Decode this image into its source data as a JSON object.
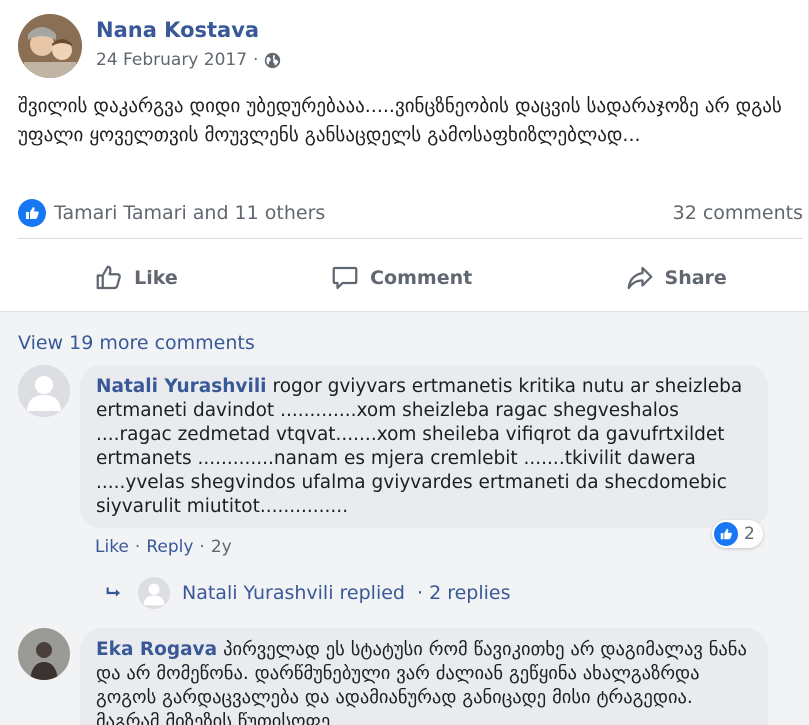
{
  "post": {
    "author": "Nana Kostava",
    "date": "24 February 2017",
    "meta_separator": "·",
    "text": "შვილის დაკარგვა დიდი უბედურებააა.....ვინცზნეობის დაცვის სადარაჯოზე არ დგას უფალი ყოველთვის მოუვლენს განსაცდელს გამოსაფხიზლებლად...",
    "reactors": "Tamari Tamari and 11 others",
    "comments_count": "32 comments",
    "actions": {
      "like": "Like",
      "comment": "Comment",
      "share": "Share"
    }
  },
  "comments_section": {
    "view_more": "View 19 more comments",
    "comments": [
      {
        "author": "Natali Yurashvili",
        "text": "rogor gviyvars ertmanetis kritika nutu ar sheizleba ertmaneti davindot .............xom sheizleba ragac shegveshalos ....ragac zedmetad vtqvat.......xom sheileba vifiqrot da gavufrtxildet ertmanets .............nanam es mjera cremlebit .......tkivilit dawera .....yvelas shegvindos ufalma gviyvardes ertmaneti da shecdomebic siyvarulit miutitot...............",
        "like": "Like",
        "reply": "Reply",
        "age": "2y",
        "reaction_count": "2"
      },
      {
        "author": "Eka Rogava",
        "text": "პირველად ეს სტატუსი რომ წავიკითხე არ დაგიმალავ ნანა და არ მომეწონა. დარწმუნებული ვარ ძალიან გეწყინა ახალგაზრდა გოგოს გარდაცვალება და ადამიანურად განიცადე მისი ტრაგედია. მაგრამ მიზეზის წუთისოფე"
      }
    ],
    "reply_summary": {
      "author": "Natali Yurashvili replied",
      "count": "· 2 replies"
    }
  },
  "colors": {
    "link_blue": "#385898",
    "like_blue": "#1877f2",
    "muted_text": "#606770",
    "bubble_bg": "#e9ebee",
    "section_bg": "#f2f3f5"
  },
  "icons": [
    "globe-icon",
    "like-reaction-icon",
    "thumbs-up-icon",
    "comment-icon",
    "share-icon",
    "reply-arrow-icon",
    "default-avatar-icon"
  ]
}
